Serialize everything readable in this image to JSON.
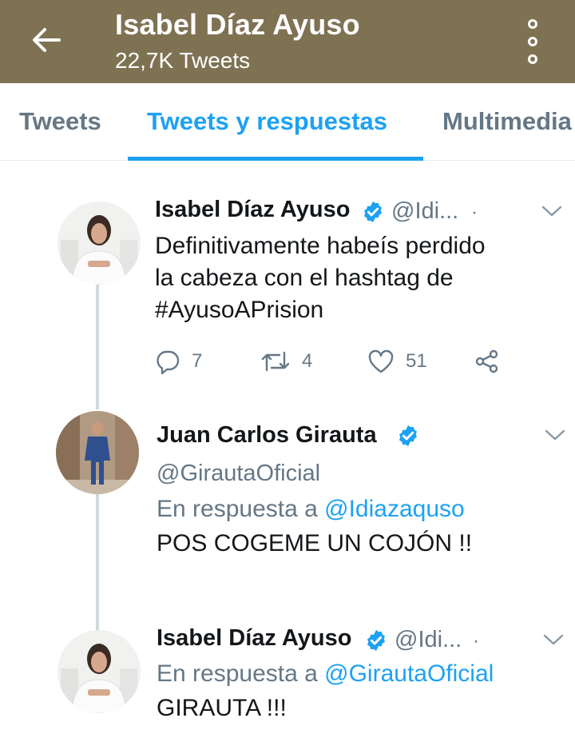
{
  "header": {
    "title": "Isabel Díaz Ayuso",
    "subtitle": "22,7K Tweets"
  },
  "tabs": [
    {
      "label": "Tweets"
    },
    {
      "label": "Tweets y respuestas"
    },
    {
      "label": "Multimedia"
    }
  ],
  "tweets": [
    {
      "name": "Isabel Díaz Ayuso",
      "handle": "@Idi...",
      "separator": "·",
      "text_lines": [
        "Definitivamente habeís perdido",
        "la cabeza con el hashtag de",
        "#AyusoAPrision"
      ],
      "replies": "7",
      "retweets": "4",
      "likes": "51"
    },
    {
      "name": "Juan Carlos Girauta",
      "handle": "@GirautaOficial",
      "reply_prefix": "En respuesta a",
      "reply_to": "@Idiazaquso",
      "text": "POS COGEME UN COJÓN !!"
    },
    {
      "name": "Isabel Díaz Ayuso",
      "handle": "@Idi...",
      "separator": "·",
      "reply_prefix": "En respuesta a",
      "reply_to": "@GirautaOficial",
      "text": "GIRAUTA !!!"
    }
  ],
  "colors": {
    "header_bg": "#7f7253",
    "accent": "#1da1f2",
    "muted": "#657786"
  }
}
